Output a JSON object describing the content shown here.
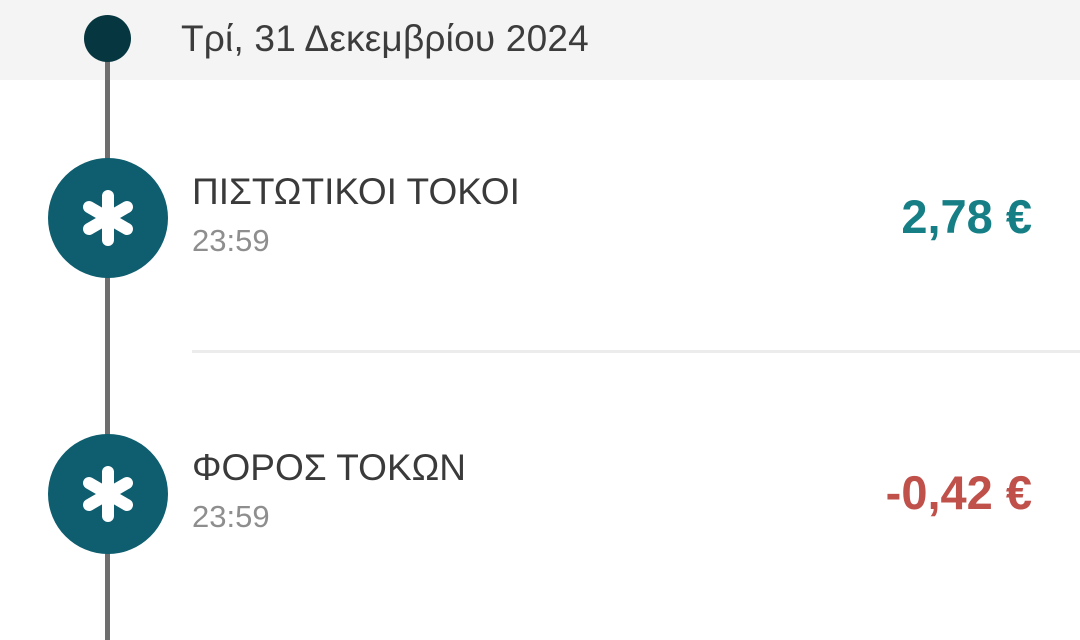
{
  "date_header": {
    "label": "Τρί, 31 Δεκεμβρίου 2024"
  },
  "transactions": [
    {
      "icon": "asterisk-icon",
      "title": "ΠΙΣΤΩΤΙΚΟΙ ΤΟΚΟΙ",
      "time": "23:59",
      "amount": "2,78 €",
      "amount_color": "#167f86"
    },
    {
      "icon": "asterisk-icon",
      "title": "ΦΟΡΟΣ ΤΟΚΩΝ",
      "time": "23:59",
      "amount": "-0,42 €",
      "amount_color": "#c0504a"
    }
  ],
  "colors": {
    "header_bg": "#f4f4f4",
    "timeline_dot": "#06363f",
    "timeline_line": "#6e6e6e",
    "icon_bg": "#0e5e6f"
  }
}
